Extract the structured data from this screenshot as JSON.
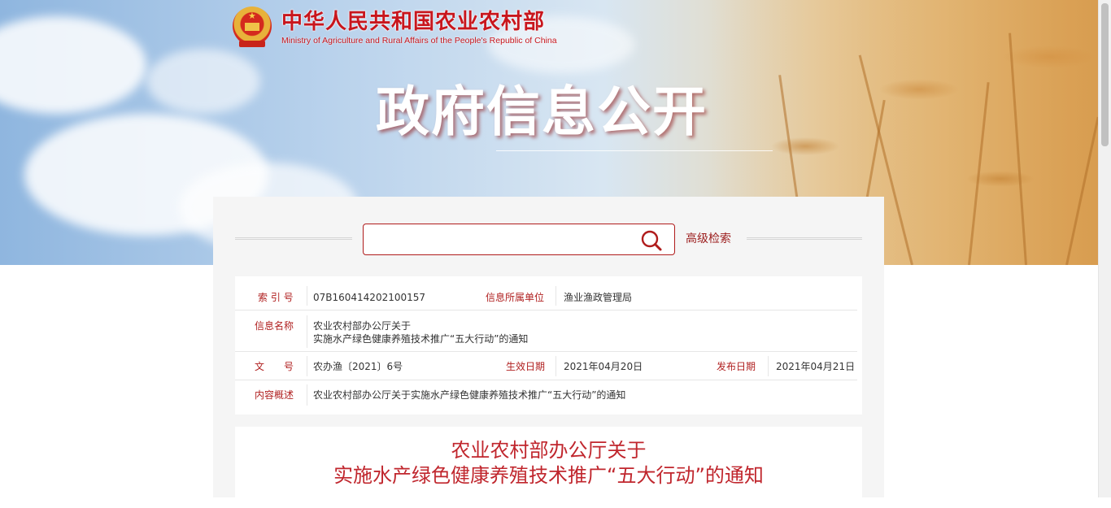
{
  "header": {
    "site_name_cn": "中华人民共和国农业农村部",
    "site_name_en": "Ministry of Agriculture and Rural Affairs of the People's Republic of China",
    "banner_title": "政府信息公开"
  },
  "search": {
    "placeholder": "",
    "value": "",
    "advanced_label": "高级检索"
  },
  "meta": {
    "index_label": "索 引 号",
    "index_value": "07B160414202100157",
    "unit_label": "信息所属单位",
    "unit_value": "渔业渔政管理局",
    "name_label": "信息名称",
    "name_value_line1": "农业农村部办公厅关于",
    "name_value_line2": "实施水产绿色健康养殖技术推广“五大行动”的通知",
    "docno_label": "文　　号",
    "docno_value": "农办渔〔2021〕6号",
    "effective_label": "生效日期",
    "effective_value": "2021年04月20日",
    "publish_label": "发布日期",
    "publish_value": "2021年04月21日",
    "summary_label": "内容概述",
    "summary_value": "农业农村部办公厅关于实施水产绿色健康养殖技术推广“五大行动”的通知"
  },
  "document": {
    "title_line1": "农业农村部办公厅关于",
    "title_line2": "实施水产绿色健康养殖技术推广“五大行动”的通知"
  },
  "colors": {
    "brand_red": "#c8161d",
    "label_red": "#b02020",
    "panel_bg": "#f5f5f5"
  }
}
